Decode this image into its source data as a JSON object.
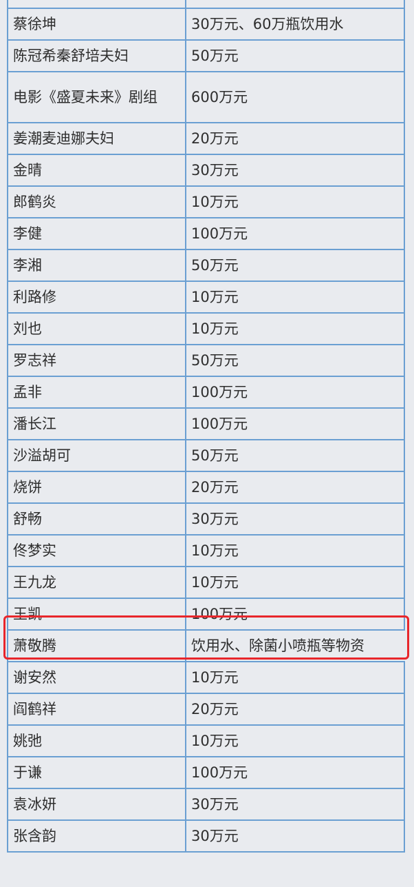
{
  "table": {
    "rows": [
      {
        "name": "",
        "amount": ""
      },
      {
        "name": "蔡徐坤",
        "amount": "30万元、60万瓶饮用水"
      },
      {
        "name": "陈冠希秦舒培夫妇",
        "amount": "50万元"
      },
      {
        "name": "电影《盛夏未来》剧组",
        "amount": "600万元"
      },
      {
        "name": "姜潮麦迪娜夫妇",
        "amount": "20万元"
      },
      {
        "name": "金晴",
        "amount": "30万元"
      },
      {
        "name": "郎鹤炎",
        "amount": "10万元"
      },
      {
        "name": "李健",
        "amount": "100万元"
      },
      {
        "name": "李湘",
        "amount": "50万元"
      },
      {
        "name": "利路修",
        "amount": "10万元"
      },
      {
        "name": "刘也",
        "amount": "10万元"
      },
      {
        "name": "罗志祥",
        "amount": "50万元"
      },
      {
        "name": "孟非",
        "amount": "100万元"
      },
      {
        "name": "潘长江",
        "amount": "100万元"
      },
      {
        "name": "沙溢胡可",
        "amount": "50万元"
      },
      {
        "name": "烧饼",
        "amount": "20万元"
      },
      {
        "name": "舒畅",
        "amount": "30万元"
      },
      {
        "name": "佟梦实",
        "amount": "10万元"
      },
      {
        "name": "王九龙",
        "amount": "10万元"
      },
      {
        "name": "王凯",
        "amount": "100万元"
      },
      {
        "name": "萧敬腾",
        "amount": "饮用水、除菌小喷瓶等物资"
      },
      {
        "name": "谢安然",
        "amount": "10万元"
      },
      {
        "name": "阎鹤祥",
        "amount": "20万元"
      },
      {
        "name": "姚弛",
        "amount": "10万元"
      },
      {
        "name": "于谦",
        "amount": "100万元"
      },
      {
        "name": "袁冰妍",
        "amount": "30万元"
      },
      {
        "name": "张含韵",
        "amount": "30万元"
      }
    ]
  },
  "highlight": {
    "row": "王凯",
    "color": "#e8262b"
  },
  "colors": {
    "border": "#6a9fd2",
    "background": "#e9ebef"
  }
}
